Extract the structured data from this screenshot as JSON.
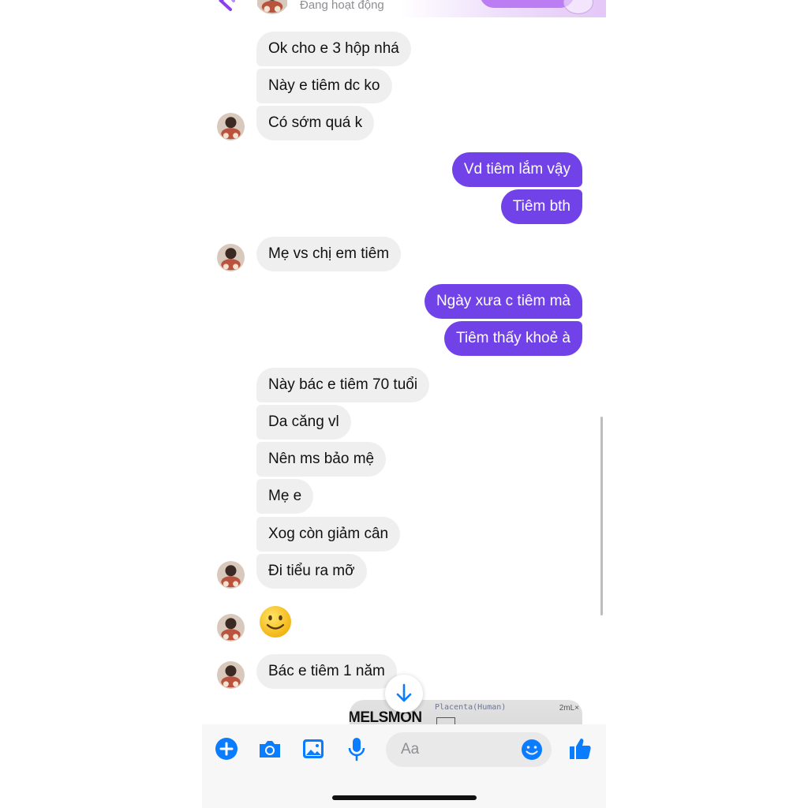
{
  "header": {
    "status": "Đang hoạt động"
  },
  "messages": [
    {
      "text": "Ok cho e 3 hộp nhá"
    },
    {
      "text": "Này e tiêm dc ko"
    },
    {
      "text": "Có sớm quá k"
    },
    {
      "text": "Vd tiêm lắm vậy"
    },
    {
      "text": "Tiêm bth"
    },
    {
      "text": "Mẹ vs chị em tiêm"
    },
    {
      "text": "Ngày xưa c tiêm mà"
    },
    {
      "text": "Tiêm thấy khoẻ à"
    },
    {
      "text": "Này bác e tiêm 70 tuổi"
    },
    {
      "text": "Da căng vl"
    },
    {
      "text": "Nên ms bảo mệ"
    },
    {
      "text": "Mẹ e"
    },
    {
      "text": "Xog còn giảm cân"
    },
    {
      "text": "Đi tiểu ra mỡ"
    },
    {
      "text": "Bác e tiêm 1 năm"
    }
  ],
  "emoji_message": "slightly-smiling-face-emoji",
  "image_preview": {
    "brand": "MELSMON",
    "subtitle": "Placenta(Human)",
    "volume": "2mL×"
  },
  "composer": {
    "placeholder": "Aa"
  },
  "colors": {
    "accent": "#0a7cff",
    "outgoing_bubble": "#7142e8",
    "incoming_bubble": "#efefef"
  },
  "icons": [
    "back-icon",
    "phone-icon",
    "video-icon",
    "plus-icon",
    "camera-icon",
    "gallery-icon",
    "microphone-icon",
    "emoji-icon",
    "like-icon",
    "arrow-down-icon"
  ]
}
